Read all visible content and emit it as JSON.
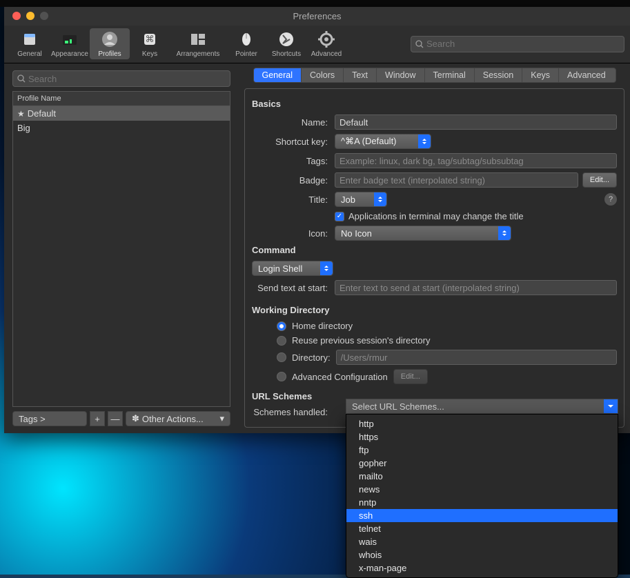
{
  "window": {
    "title": "Preferences"
  },
  "toolbar": {
    "items": [
      {
        "id": "general",
        "label": "General"
      },
      {
        "id": "appearance",
        "label": "Appearance"
      },
      {
        "id": "profiles",
        "label": "Profiles"
      },
      {
        "id": "keys",
        "label": "Keys"
      },
      {
        "id": "arrangements",
        "label": "Arrangements"
      },
      {
        "id": "pointer",
        "label": "Pointer"
      },
      {
        "id": "shortcuts",
        "label": "Shortcuts"
      },
      {
        "id": "advanced",
        "label": "Advanced"
      }
    ],
    "active": "profiles",
    "search_placeholder": "Search"
  },
  "sidebar": {
    "search_placeholder": "Search",
    "header": "Profile Name",
    "profiles": [
      {
        "name": "Default",
        "starred": true,
        "selected": true
      },
      {
        "name": "Big",
        "starred": false,
        "selected": false
      }
    ],
    "tags_button": "Tags >",
    "add": "+",
    "remove": "—",
    "other_actions": "Other Actions..."
  },
  "tabs": {
    "items": [
      "General",
      "Colors",
      "Text",
      "Window",
      "Terminal",
      "Session",
      "Keys",
      "Advanced"
    ],
    "active": "General"
  },
  "form": {
    "basics_header": "Basics",
    "name_label": "Name:",
    "name_value": "Default",
    "shortcut_label": "Shortcut key:",
    "shortcut_value": "^⌘A (Default)",
    "tags_label": "Tags:",
    "tags_placeholder": "Example: linux, dark bg, tag/subtag/subsubtag",
    "badge_label": "Badge:",
    "badge_placeholder": "Enter badge text (interpolated string)",
    "badge_edit": "Edit...",
    "title_label": "Title:",
    "title_value": "Job",
    "title_checkbox": "Applications in terminal may change the title",
    "title_help": "?",
    "icon_label": "Icon:",
    "icon_value": "No Icon",
    "command_header": "Command",
    "command_value": "Login Shell",
    "send_text_label": "Send text at start:",
    "send_text_placeholder": "Enter text to send at start (interpolated string)",
    "wd_header": "Working Directory",
    "wd_options": [
      "Home directory",
      "Reuse previous session's directory",
      "Directory:",
      "Advanced Configuration"
    ],
    "wd_dir_placeholder": "/Users/rmur",
    "wd_edit": "Edit...",
    "url_header": "URL Schemes",
    "schemes_label": "Schemes handled:",
    "schemes_value": "Select URL Schemes..."
  },
  "dropdown": {
    "options": [
      "http",
      "https",
      "ftp",
      "gopher",
      "mailto",
      "news",
      "nntp",
      "ssh",
      "telnet",
      "wais",
      "whois",
      "x-man-page"
    ],
    "hover": "ssh"
  }
}
